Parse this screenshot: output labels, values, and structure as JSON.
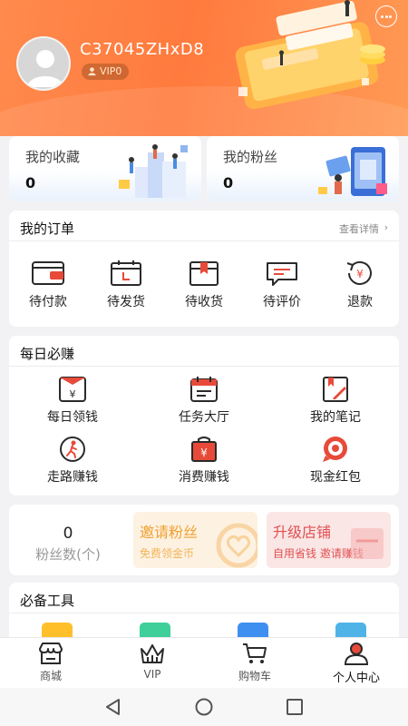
{
  "profile": {
    "username": "C37045ZHxD8",
    "vip_level": "VIP0"
  },
  "stats": [
    {
      "label": "我的收藏",
      "value": "0"
    },
    {
      "label": "我的粉丝",
      "value": "0"
    }
  ],
  "orders": {
    "title": "我的订单",
    "detail_link": "查看详情",
    "items": [
      {
        "label": "待付款",
        "icon": "wallet-icon"
      },
      {
        "label": "待发货",
        "icon": "calendar-icon"
      },
      {
        "label": "待收货",
        "icon": "box-icon"
      },
      {
        "label": "待评价",
        "icon": "chat-icon"
      },
      {
        "label": "退款",
        "icon": "yen-refund-icon"
      }
    ]
  },
  "daily": {
    "title": "每日必赚",
    "items": [
      {
        "label": "每日领钱",
        "icon": "yen-envelope-icon"
      },
      {
        "label": "任务大厅",
        "icon": "task-calendar-icon"
      },
      {
        "label": "我的笔记",
        "icon": "notebook-icon"
      },
      {
        "label": "走路赚钱",
        "icon": "walking-icon"
      },
      {
        "label": "消费赚钱",
        "icon": "yen-bag-icon"
      },
      {
        "label": "现金红包",
        "icon": "red-packet-icon"
      }
    ]
  },
  "fans": {
    "count": "0",
    "label": "粉丝数(个)"
  },
  "promos": [
    {
      "title": "邀请粉丝",
      "subtitle": "免费领金币",
      "color": "#f0a030"
    },
    {
      "title": "升级店铺",
      "subtitle": "自用省钱 邀请赚钱",
      "color": "#e05050"
    }
  ],
  "tools": {
    "title": "必备工具"
  },
  "tabbar": [
    {
      "label": "商城",
      "icon": "store-icon"
    },
    {
      "label": "VIP",
      "icon": "crown-icon"
    },
    {
      "label": "购物车",
      "icon": "cart-icon"
    },
    {
      "label": "个人中心",
      "icon": "person-icon",
      "active": true
    }
  ],
  "colors": {
    "accent": "#ff7a3d",
    "icon_red": "#e84a3a",
    "icon_dark": "#2a2a2a"
  }
}
